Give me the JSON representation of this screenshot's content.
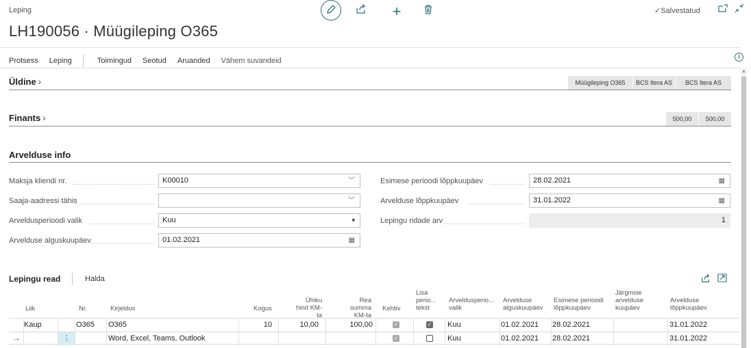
{
  "header": {
    "breadcrumb": "Leping",
    "title": "LH190056 · Müügileping O365",
    "saved_label": "Salvestatud"
  },
  "toolbar_icons": [
    "edit-icon",
    "share-icon",
    "add-icon",
    "delete-icon"
  ],
  "actions": {
    "items": [
      "Protsess",
      "Leping",
      "Toimingud",
      "Seotud",
      "Aruanded",
      "Vähem suvandeid"
    ]
  },
  "sections": {
    "general": {
      "title": "Üldine",
      "pills": [
        "Müügileping O365",
        "BCS Itera AS",
        "BCS Itera AS"
      ]
    },
    "finance": {
      "title": "Finants",
      "pills": [
        "500,00",
        "500,00"
      ]
    },
    "billing": {
      "title": "Arvelduse info"
    }
  },
  "billing_form": {
    "left": [
      {
        "label": "Maksja kliendi nr.",
        "value": "K00010",
        "icon": "chevron-down-icon"
      },
      {
        "label": "Saaja-aadressi tähis",
        "value": "",
        "icon": "chevron-down-icon"
      },
      {
        "label": "Arveldusperioodi valik",
        "value": "Kuu",
        "icon": "select-arrow-icon"
      },
      {
        "label": "Arvelduse alguskuupäev",
        "value": "01.02.2021",
        "icon": "calendar-icon"
      }
    ],
    "right": [
      {
        "label": "Esimese perioodi lõppkuupäev",
        "value": "28.02.2021",
        "icon": "calendar-icon"
      },
      {
        "label": "Arvelduse lõppkuupäev",
        "value": "31.01.2022",
        "icon": "calendar-icon"
      },
      {
        "label": "Lepingu ridade arv",
        "value": "1",
        "icon": ""
      }
    ]
  },
  "lines": {
    "title": "Lepingu read",
    "manage": "Halda",
    "columns": [
      "Liik",
      "Nr.",
      "Kirjeldus",
      "Kogus",
      "Ühiku hind KM-ta",
      "Rea summa KM-ta",
      "Kehtiv",
      "Lisa perio... tekst",
      "Arveldusperio... valik",
      "Arvelduse alguskuupäev",
      "Esimese perioodi lõppkuupäev",
      "Järgmsie arvelduse kuupäev",
      "Arvelduse lõppkuupäev"
    ],
    "rows": [
      {
        "marker": "",
        "type": "Kaup",
        "no": "O365",
        "desc": "O365",
        "qty": "10",
        "price": "10,00",
        "amount": "100,00",
        "valid": true,
        "extra": true,
        "period": "Kuu",
        "start": "01.02.2021",
        "first_end": "28.02.2021",
        "next": "",
        "end": "31.01.2022"
      },
      {
        "marker": "→",
        "type": "",
        "no": "",
        "desc": "Word, Excel, Teams, Outlook",
        "qty": "",
        "price": "",
        "amount": "",
        "valid": true,
        "extra": false,
        "period": "Kuu",
        "start": "01.02.2021",
        "first_end": "28.02.2021",
        "next": "",
        "end": "31.01.2022"
      }
    ]
  }
}
